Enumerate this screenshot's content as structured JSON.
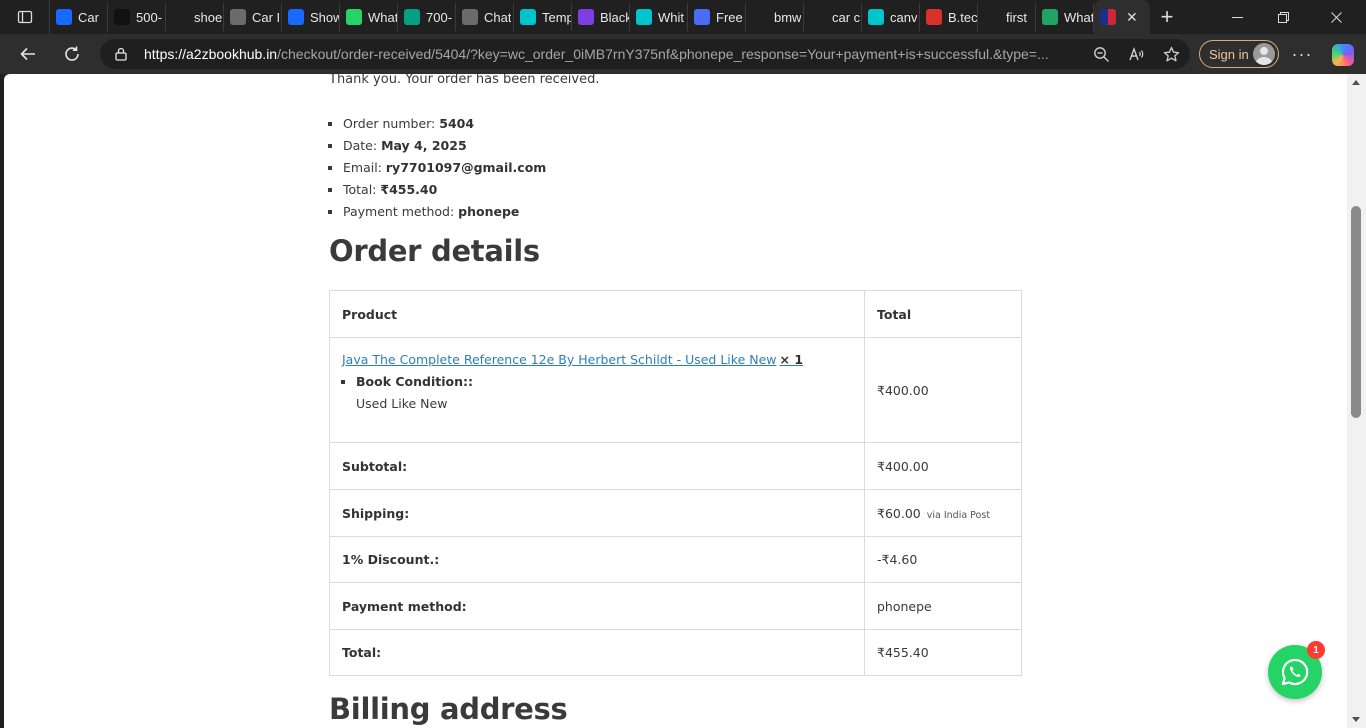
{
  "browser": {
    "tabs": [
      {
        "label": "Car",
        "icon": "behance-icon",
        "color": "#1769ff"
      },
      {
        "label": "500-",
        "icon": "building-icon",
        "color": "#111111"
      },
      {
        "label": "shoe",
        "icon": "search-icon",
        "color": "#202020"
      },
      {
        "label": "Car I",
        "icon": "chatgpt-icon",
        "color": "#6b6b6b"
      },
      {
        "label": "Show",
        "icon": "behance-icon",
        "color": "#1769ff"
      },
      {
        "label": "What",
        "icon": "whatsapp-icon",
        "color": "#25d366"
      },
      {
        "label": "700-",
        "icon": "pexels-icon",
        "color": "#05a081"
      },
      {
        "label": "Chat",
        "icon": "chatgpt-icon",
        "color": "#6b6b6b"
      },
      {
        "label": "Temp",
        "icon": "canva-icon",
        "color": "#00c4cc"
      },
      {
        "label": "Black",
        "icon": "heart-icon",
        "color": "#7b3fe4"
      },
      {
        "label": "Whit",
        "icon": "canva-icon",
        "color": "#00c4cc"
      },
      {
        "label": "Free",
        "icon": "document-icon",
        "color": "#4a6cf7"
      },
      {
        "label": "bmw",
        "icon": "search-icon",
        "color": "#202020"
      },
      {
        "label": "car c",
        "icon": "search-icon",
        "color": "#202020"
      },
      {
        "label": "canv",
        "icon": "canva-icon",
        "color": "#00c4cc"
      },
      {
        "label": "B.tec",
        "icon": "pdf-icon",
        "color": "#d9302c"
      },
      {
        "label": "first",
        "icon": "search-icon",
        "color": "#202020"
      },
      {
        "label": "What",
        "icon": "edge-icon",
        "color": "#1fa463"
      }
    ],
    "url_host": "https://a2zbookhub.in",
    "url_path": "/checkout/order-received/5404/?key=wc_order_0iMB7rnY375nf&phonepe_response=Your+payment+is+successful.&type=...",
    "signin_label": "Sign in"
  },
  "page": {
    "thanks_text": "Thank you. Your order has been received.",
    "overview": [
      {
        "label": "Order number: ",
        "value": "5404"
      },
      {
        "label": "Date: ",
        "value": "May 4, 2025"
      },
      {
        "label": "Email: ",
        "value": "ry7701097@gmail.com"
      },
      {
        "label": "Total: ",
        "value": "₹455.40"
      },
      {
        "label": "Payment method: ",
        "value": "phonepe"
      }
    ],
    "order_details_title": "Order details",
    "table": {
      "col_product": "Product",
      "col_total": "Total",
      "item": {
        "name": "Java The Complete Reference 12e By Herbert Schildt - Used Like New",
        "qty": "× 1",
        "meta_key": "Book Condition::",
        "meta_value": "Used Like New",
        "total": "₹400.00"
      },
      "subtotal_label": "Subtotal:",
      "subtotal_value": "₹400.00",
      "shipping_label": "Shipping:",
      "shipping_value": "₹60.00",
      "shipping_via": "via India Post",
      "discount_label": "1% Discount.:",
      "discount_value": "-₹4.60",
      "payment_label": "Payment method:",
      "payment_value": "phonepe",
      "total_label": "Total:",
      "total_value": "₹455.40"
    },
    "billing_title": "Billing address"
  },
  "chat_widget": {
    "badge_count": "1"
  }
}
